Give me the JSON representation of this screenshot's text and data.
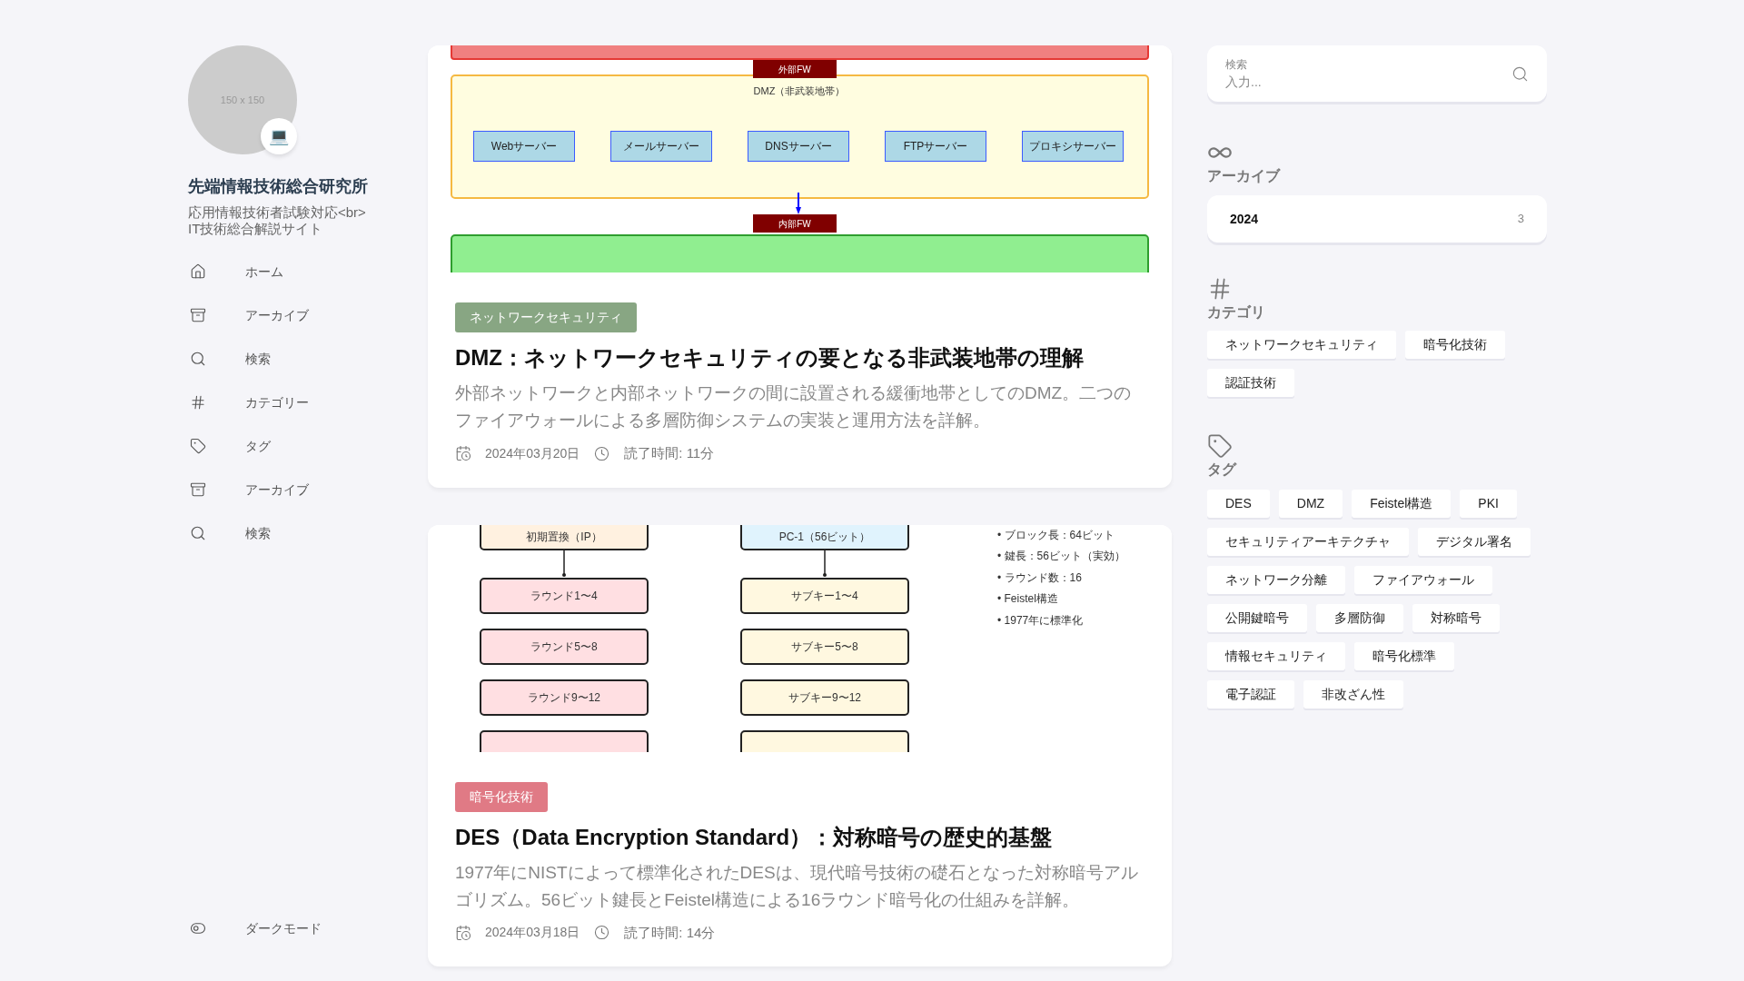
{
  "sidebar": {
    "avatar": {
      "image_text": "150 x 150",
      "badge": "💻"
    },
    "site_title": "先端情報技術総合研究所",
    "site_subtitle": "応用情報技術者試験対応<br>IT技術総合解説サイト",
    "nav": [
      {
        "kind": "home",
        "label": "ホーム"
      },
      {
        "kind": "archive",
        "label": "アーカイブ"
      },
      {
        "kind": "search",
        "label": "検索"
      },
      {
        "kind": "category",
        "label": "カテゴリー"
      },
      {
        "kind": "tag",
        "label": "タグ"
      },
      {
        "kind": "archive",
        "label": "アーカイブ"
      },
      {
        "kind": "search",
        "label": "検索"
      }
    ],
    "dark_mode": {
      "label": "ダークモード"
    }
  },
  "posts": [
    {
      "diagram": {
        "kind": "dmz",
        "outer_fw": "外部FW",
        "zone_title": "DMZ（非武装地帯）",
        "servers": [
          "Webサーバー",
          "メールサーバー",
          "DNSサーバー",
          "FTPサーバー",
          "プロキシサーバー"
        ],
        "inner_fw": "内部FW"
      },
      "category": {
        "label": "ネットワークセキュリティ",
        "color": "#88a683"
      },
      "title": "DMZ：ネットワークセキュリティの要となる非武装地帯の理解",
      "excerpt": "外部ネットワークと内部ネットワークの間に設置される緩衝地帯としてのDMZ。二つのファイアウォールによる多層防御システムの実装と運用方法を詳解。",
      "date": "2024年03月20日",
      "read_time": "読了時間: 11分"
    },
    {
      "diagram": {
        "kind": "des",
        "left_start": "初期置換（IP）",
        "left_steps": [
          "ラウンド1〜4",
          "ラウンド5〜8",
          "ラウンド9〜12"
        ],
        "right_start": "PC-1（56ビット）",
        "right_steps": [
          "サブキー1〜4",
          "サブキー5〜8",
          "サブキー9〜12"
        ],
        "notes": [
          "• ブロック長：64ビット",
          "• 鍵長：56ビット（実効）",
          "• ラウンド数：16",
          "• Feistel構造",
          "• 1977年に標準化"
        ]
      },
      "category": {
        "label": "暗号化技術",
        "color": "#e07a85"
      },
      "title": "DES（Data Encryption Standard）：対称暗号の歴史的基盤",
      "excerpt": "1977年にNISTによって標準化されたDESは、現代暗号技術の礎石となった対称暗号アルゴリズム。56ビット鍵長とFeistel構造による16ラウンド暗号化の仕組みを詳解。",
      "date": "2024年03月18日",
      "read_time": "読了時間: 14分"
    }
  ],
  "search": {
    "label": "検索",
    "placeholder": "入力..."
  },
  "archive": {
    "title": "アーカイブ",
    "items": [
      {
        "year": "2024",
        "count": "3"
      }
    ]
  },
  "categories": {
    "title": "カテゴリ",
    "items": [
      "ネットワークセキュリティ",
      "暗号化技術",
      "認証技術"
    ]
  },
  "tags": {
    "title": "タグ",
    "items": [
      "DES",
      "DMZ",
      "Feistel構造",
      "PKI",
      "セキュリティアーキテクチャ",
      "デジタル署名",
      "ネットワーク分離",
      "ファイアウォール",
      "公開鍵暗号",
      "多層防御",
      "対称暗号",
      "情報セキュリティ",
      "暗号化標準",
      "電子認証",
      "非改ざん性"
    ]
  }
}
